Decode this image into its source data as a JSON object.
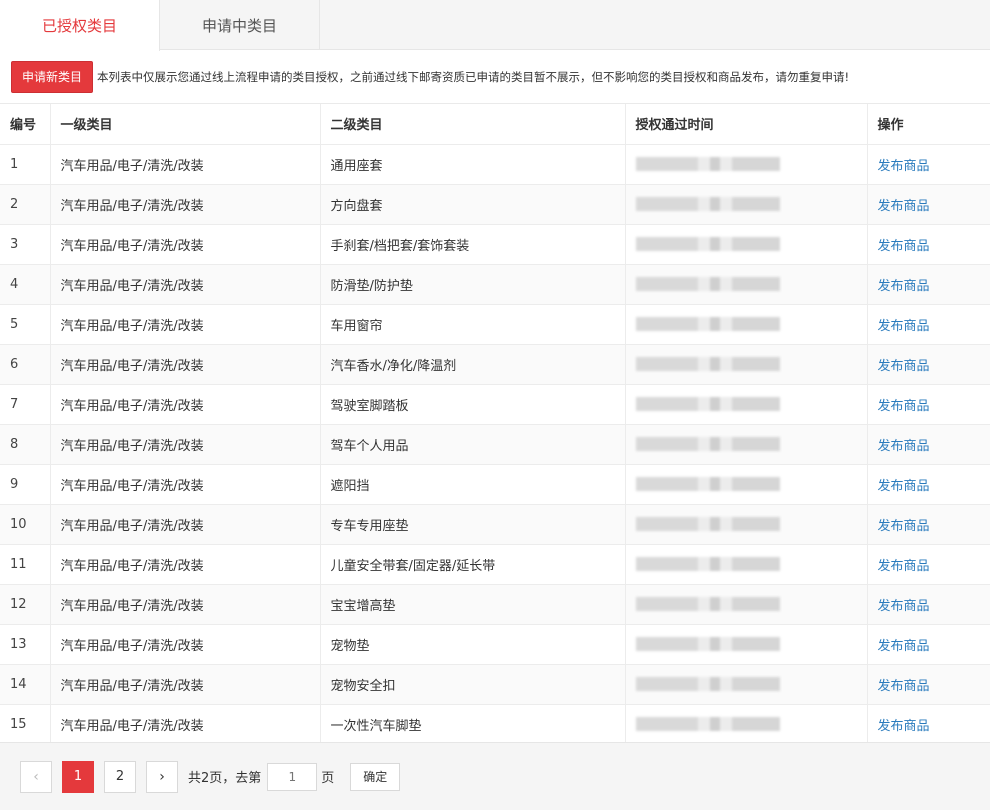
{
  "tabs": [
    {
      "label": "已授权类目",
      "active": true
    },
    {
      "label": "申请中类目",
      "active": false
    }
  ],
  "notice": {
    "apply_button": "申请新类目",
    "text": "本列表中仅展示您通过线上流程申请的类目授权，之前通过线下邮寄资质已申请的类目暂不展示，但不影响您的类目授权和商品发布，请勿重复申请!"
  },
  "table": {
    "headers": [
      "编号",
      "一级类目",
      "二级类目",
      "授权通过时间",
      "操作"
    ],
    "rows": [
      {
        "id": "1",
        "level1": "汽车用品/电子/清洗/改装",
        "level2": "通用座套",
        "action": "发布商品"
      },
      {
        "id": "2",
        "level1": "汽车用品/电子/清洗/改装",
        "level2": "方向盘套",
        "action": "发布商品"
      },
      {
        "id": "3",
        "level1": "汽车用品/电子/清洗/改装",
        "level2": "手刹套/档把套/套饰套装",
        "action": "发布商品"
      },
      {
        "id": "4",
        "level1": "汽车用品/电子/清洗/改装",
        "level2": "防滑垫/防护垫",
        "action": "发布商品"
      },
      {
        "id": "5",
        "level1": "汽车用品/电子/清洗/改装",
        "level2": "车用窗帘",
        "action": "发布商品"
      },
      {
        "id": "6",
        "level1": "汽车用品/电子/清洗/改装",
        "level2": "汽车香水/净化/降温剂",
        "action": "发布商品"
      },
      {
        "id": "7",
        "level1": "汽车用品/电子/清洗/改装",
        "level2": "驾驶室脚踏板",
        "action": "发布商品"
      },
      {
        "id": "8",
        "level1": "汽车用品/电子/清洗/改装",
        "level2": "驾车个人用品",
        "action": "发布商品"
      },
      {
        "id": "9",
        "level1": "汽车用品/电子/清洗/改装",
        "level2": "遮阳挡",
        "action": "发布商品"
      },
      {
        "id": "10",
        "level1": "汽车用品/电子/清洗/改装",
        "level2": "专车专用座垫",
        "action": "发布商品"
      },
      {
        "id": "11",
        "level1": "汽车用品/电子/清洗/改装",
        "level2": "儿童安全带套/固定器/延长带",
        "action": "发布商品"
      },
      {
        "id": "12",
        "level1": "汽车用品/电子/清洗/改装",
        "level2": "宝宝增高垫",
        "action": "发布商品"
      },
      {
        "id": "13",
        "level1": "汽车用品/电子/清洗/改装",
        "level2": "宠物垫",
        "action": "发布商品"
      },
      {
        "id": "14",
        "level1": "汽车用品/电子/清洗/改装",
        "level2": "宠物安全扣",
        "action": "发布商品"
      },
      {
        "id": "15",
        "level1": "汽车用品/电子/清洗/改装",
        "level2": "一次性汽车脚垫",
        "action": "发布商品"
      }
    ]
  },
  "pagination": {
    "prev_icon": "chevron-left-icon",
    "next_icon": "chevron-right-icon",
    "pages": [
      "1",
      "2"
    ],
    "current": "1",
    "total_text": "共2页，去第",
    "page_suffix": "页",
    "goto_placeholder": "1",
    "confirm_label": "确定"
  },
  "colors": {
    "accent": "#e4393c",
    "link": "#2a7bbd"
  }
}
